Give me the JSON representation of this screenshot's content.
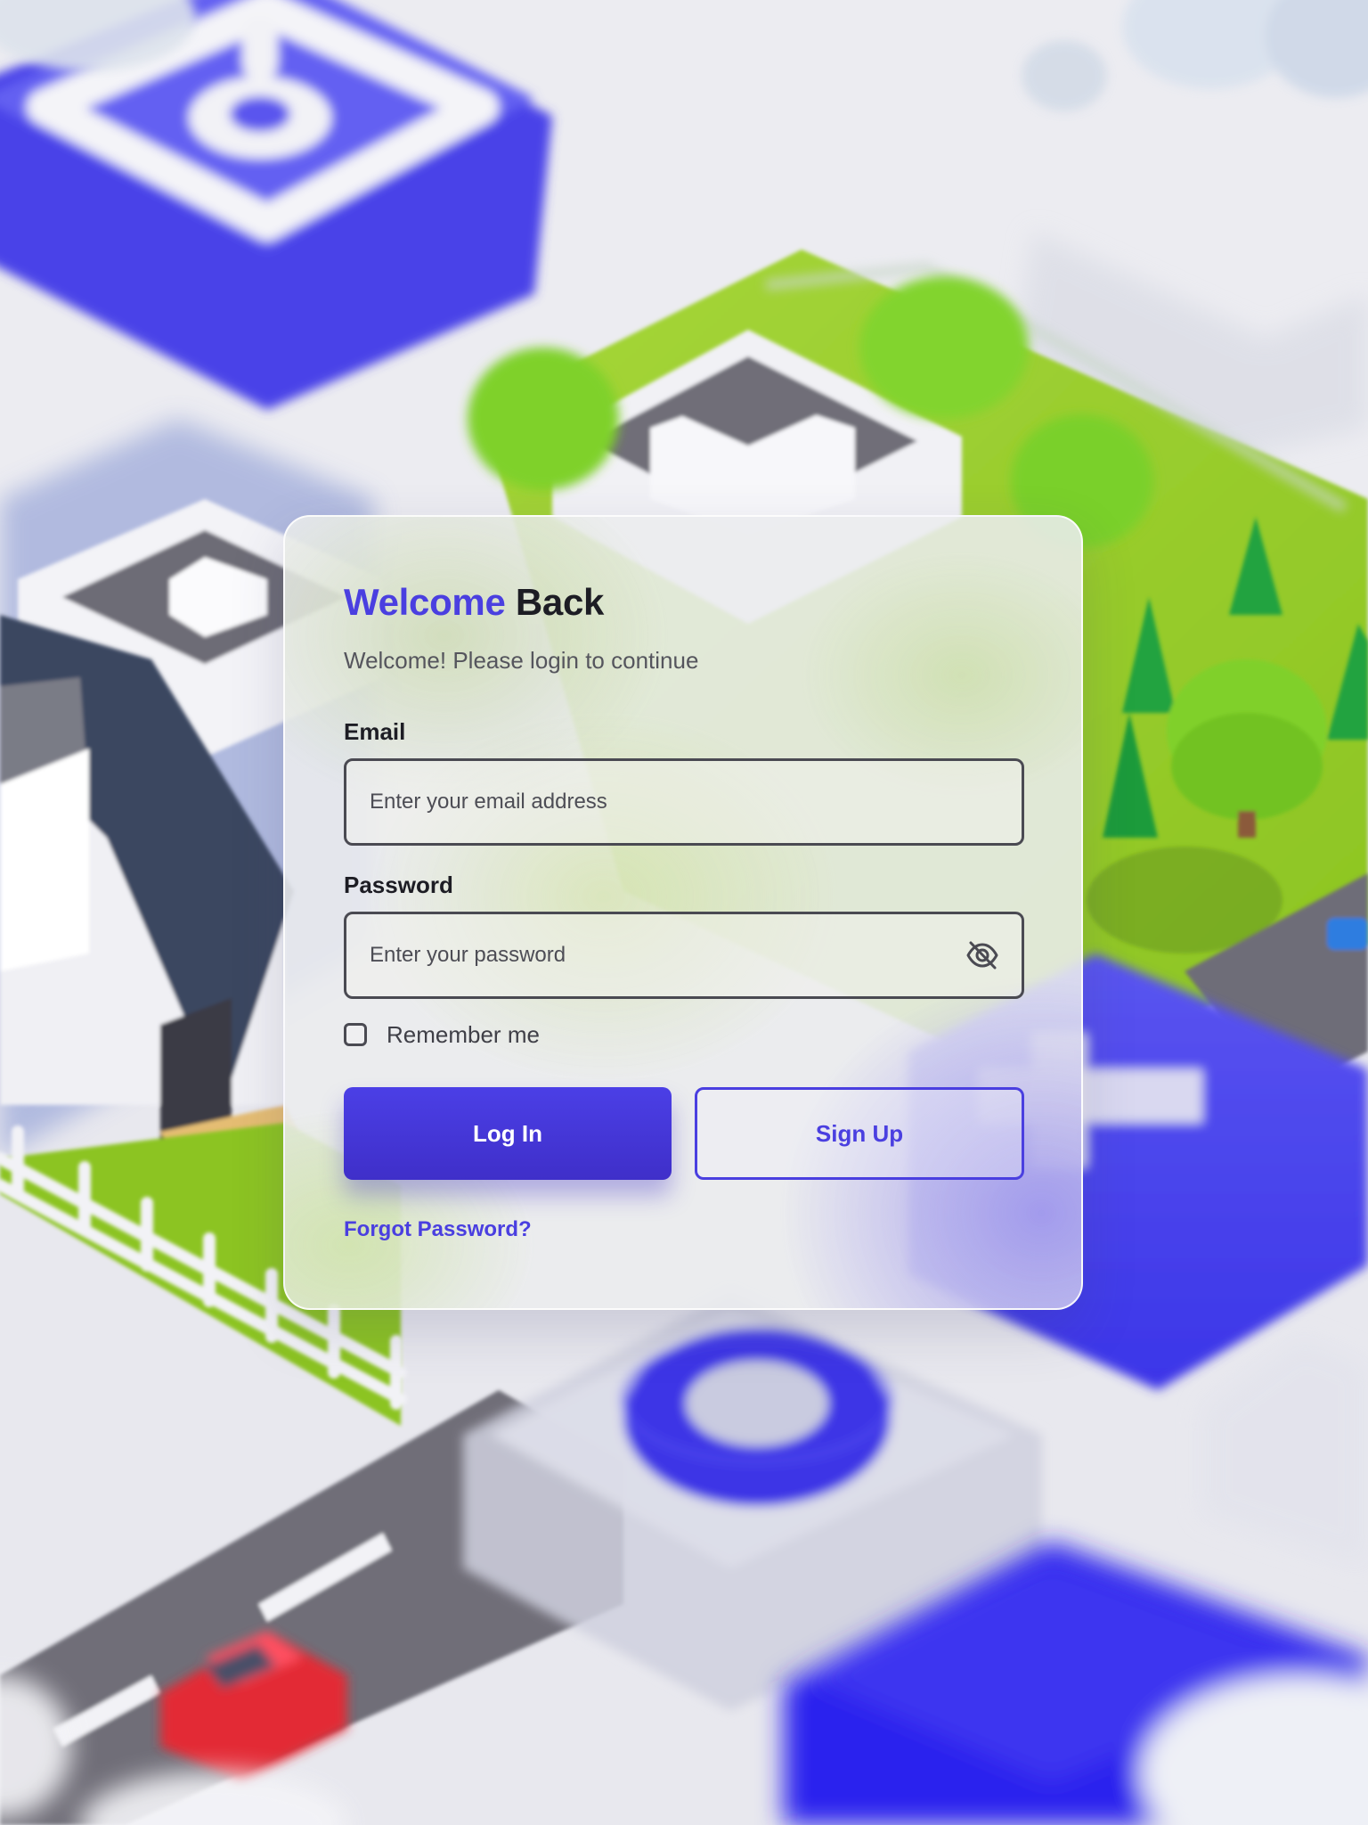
{
  "login": {
    "title_accent": "Welcome",
    "title_rest": "Back",
    "subtitle": "Welcome! Please login to continue",
    "email": {
      "label": "Email",
      "placeholder": "Enter your email address"
    },
    "password": {
      "label": "Password",
      "placeholder": "Enter your password",
      "toggle_icon": "eye-off-icon"
    },
    "remember_me": {
      "label": "Remember me",
      "checked": false
    },
    "login_button": "Log In",
    "signup_button": "Sign Up",
    "forgot_password": "Forgot Password?"
  },
  "colors": {
    "accent": "#4a3fe0",
    "text_dark": "#1d1d24",
    "text_muted": "#55555d",
    "input_border": "#4a4a52"
  },
  "background": {
    "description_icons": [
      "lock-block",
      "house",
      "trees",
      "road",
      "red-car",
      "blue-ring",
      "plus-block"
    ]
  }
}
